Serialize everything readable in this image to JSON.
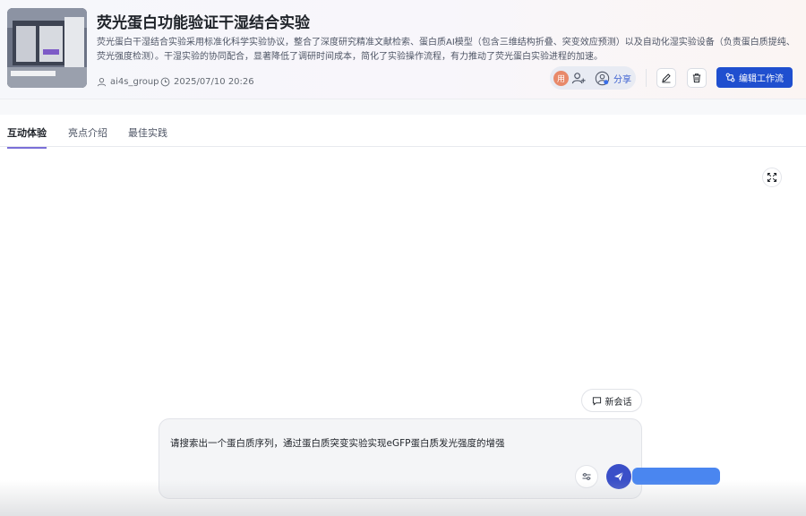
{
  "header": {
    "title": "荧光蛋白功能验证干湿结合实验",
    "description": "荧光蛋白干湿结合实验采用标准化科学实验协议，整合了深度研究精准文献检索、蛋白质AI模型（包含三维结构折叠、突变效应预测）以及自动化湿实验设备（负责蛋白质提纯、荧光强度检测）。干湿实验的协同配合，显著降低了调研时间成本，简化了实验操作流程，有力推动了荧光蛋白实验进程的加速。",
    "author": "ai4s_group",
    "timestamp": "2025/07/10 20:26",
    "avatar_char": "用",
    "share_label": "分享",
    "edit_workflow_label": "编辑工作流"
  },
  "tabs": [
    {
      "label": "互动体验",
      "active": true
    },
    {
      "label": "亮点介绍",
      "active": false
    },
    {
      "label": "最佳实践",
      "active": false
    }
  ],
  "chat": {
    "new_chat_label": "新会话",
    "input_value": "请搜索出一个蛋白质序列，通过蛋白质突变实验实现eGFP蛋白质发光强度的增强"
  },
  "colors": {
    "primary": "#1f4fcf",
    "tab_underline": "#7a6fd8",
    "send_button": "#3a4fc8",
    "avatar": "#e8896a"
  },
  "icons": [
    "user-icon",
    "clock-icon",
    "add-member-icon",
    "share-user-icon",
    "pencil-icon",
    "trash-icon",
    "workflow-icon",
    "fullscreen-icon",
    "chat-bubble-icon",
    "sliders-icon",
    "send-icon"
  ]
}
